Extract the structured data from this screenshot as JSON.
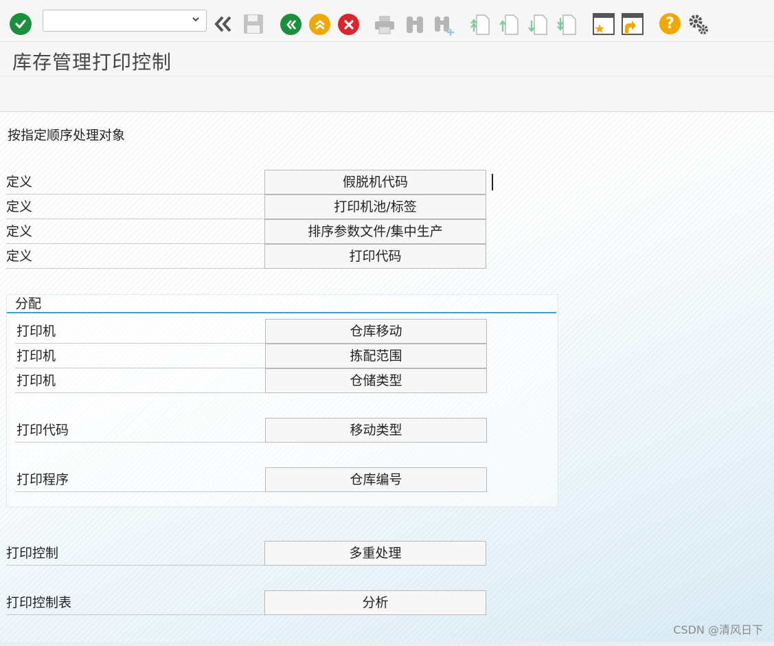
{
  "toolbar": {
    "command_field_value": "",
    "colors": {
      "green": "#1a8f3c",
      "orange": "#f0a800",
      "red": "#d9262c",
      "gray": "#9a9a9a",
      "light_green": "#7cc99a"
    }
  },
  "title": "库存管理打印控制",
  "heading": "按指定顺序处理对象",
  "define_rows": [
    {
      "label": "定义",
      "button": "假脱机代码"
    },
    {
      "label": "定义",
      "button": "打印机池/标签"
    },
    {
      "label": "定义",
      "button": "排序参数文件/集中生产"
    },
    {
      "label": "定义",
      "button": "打印代码"
    }
  ],
  "assign_group": {
    "title": "分配",
    "rows": [
      {
        "label": "打印机",
        "button": "仓库移动"
      },
      {
        "label": "打印机",
        "button": "拣配范围"
      },
      {
        "label": "打印机",
        "button": "仓储类型"
      },
      {
        "label": "打印代码",
        "button": "移动类型"
      },
      {
        "label": "打印程序",
        "button": "仓库编号"
      }
    ]
  },
  "bottom_rows": [
    {
      "label": "打印控制",
      "button": "多重处理"
    },
    {
      "label": "打印控制表",
      "button": "分析"
    }
  ],
  "watermark": "CSDN @清风日下"
}
